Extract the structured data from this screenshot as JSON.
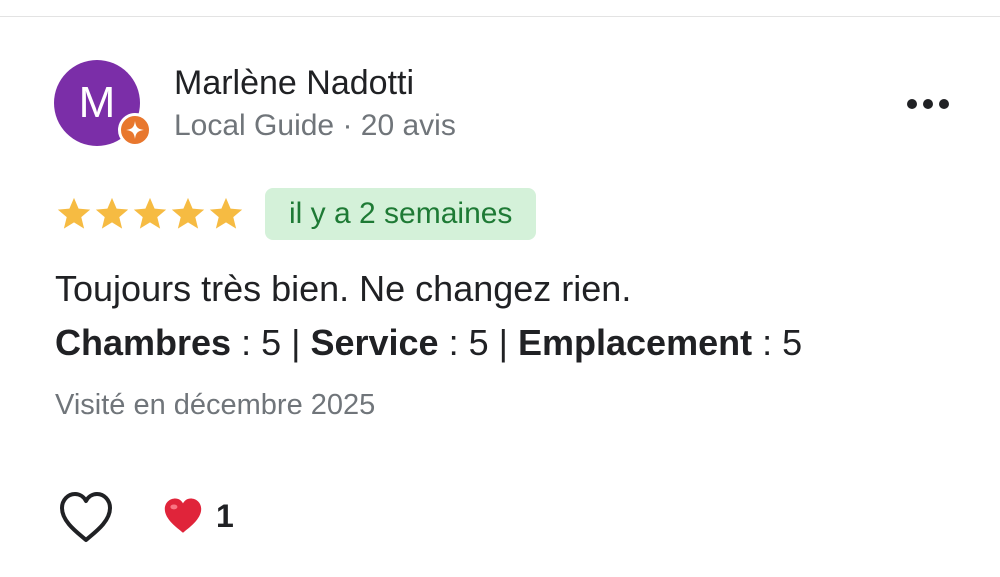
{
  "review": {
    "author": {
      "initial": "M",
      "name": "Marlène Nadotti",
      "meta": "Local Guide · 20 avis"
    },
    "rating": 5,
    "rating_max": 5,
    "date": "il y a 2 semaines",
    "text": "Toujours très bien. Ne changez rien.",
    "sub_ratings": [
      {
        "label": "Chambres",
        "value": "5"
      },
      {
        "label": "Service",
        "value": "5"
      },
      {
        "label": "Emplacement",
        "value": "5"
      }
    ],
    "visited": "Visité en décembre 2025",
    "reactions": {
      "count": "1"
    }
  },
  "colors": {
    "avatar_bg": "#7b2ea8",
    "guide_badge": "#e8772e",
    "star": "#f6bb42",
    "chip_bg": "#d4f1d9",
    "chip_text": "#1e7a35",
    "heart": "#e0243a"
  },
  "icons": {
    "more": "more-horizontal-icon",
    "like": "heart-outline-icon",
    "reaction": "red-heart-icon",
    "badge": "local-guide-star-icon"
  }
}
